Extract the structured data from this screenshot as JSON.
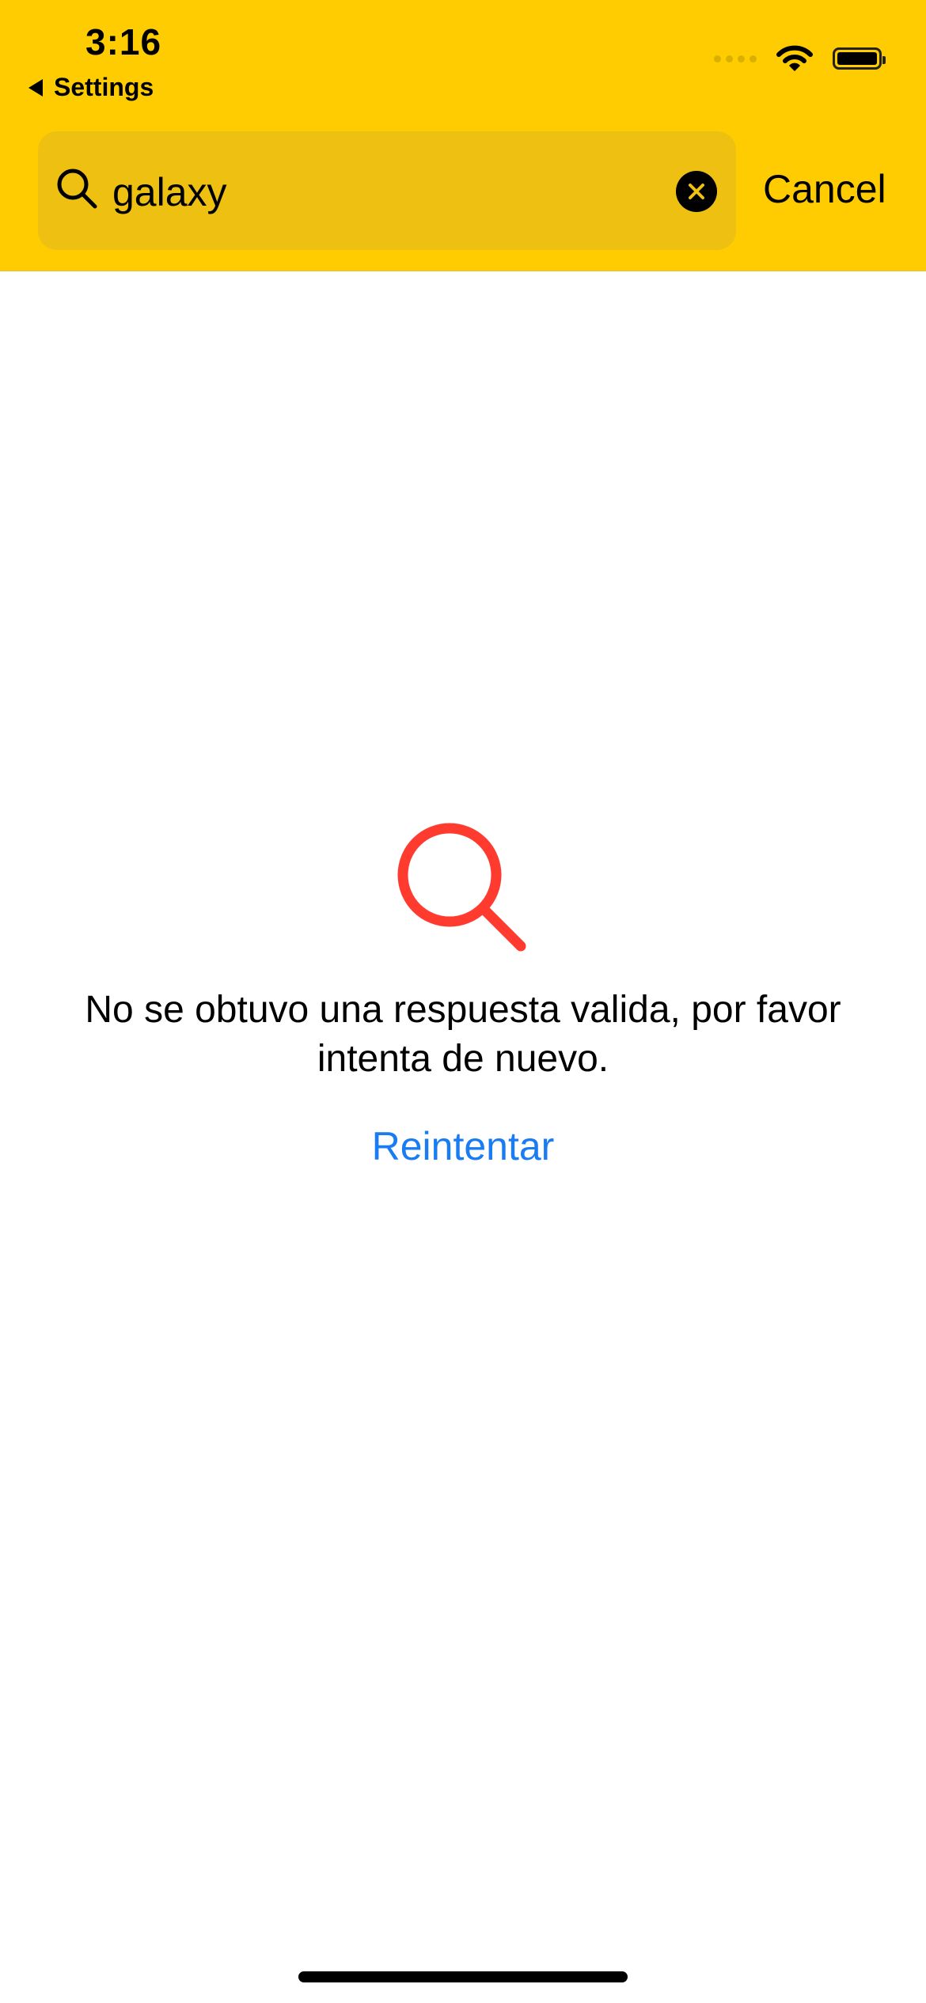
{
  "status_bar": {
    "time": "3:16",
    "back_label": "Settings"
  },
  "search": {
    "query": "galaxy",
    "cancel_label": "Cancel"
  },
  "empty_state": {
    "message": "No se obtuvo una respuesta valida, por favor intenta de nuevo.",
    "retry_label": "Reintentar",
    "icon": "search-icon"
  },
  "colors": {
    "header_bg": "#FECC00",
    "search_field_bg": "#EDC011",
    "icon_red": "#FF3B30",
    "link_blue": "#1A7CF2"
  }
}
